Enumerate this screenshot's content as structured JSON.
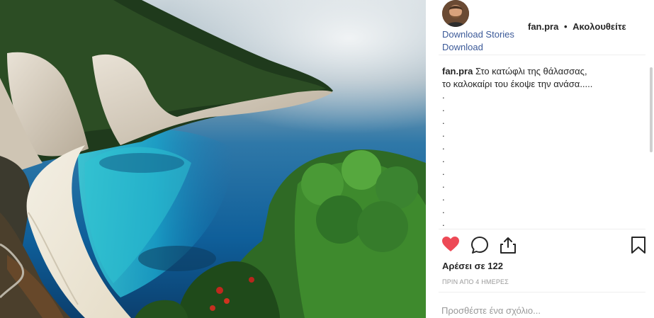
{
  "post": {
    "username": "fan.pra",
    "follow_separator": "•",
    "follow_label": "Ακολουθείτε",
    "download_stories_label": "Download Stories",
    "download_label": "Download",
    "caption_user": "fan.pra",
    "caption_line1": "Στο κατώφλι της θάλασσας,",
    "caption_line2": "το καλοκαίρι του έκοψε την ανάσα.....",
    "caption_dots": [
      ".",
      ".",
      ".",
      ".",
      ".",
      ".",
      ".",
      ".",
      ".",
      ".",
      "."
    ],
    "likes_text": "Αρέσει σε 122",
    "time_ago": "ΠΡΙΝ ΑΠΟ 4 ΗΜΕΡΕΣ",
    "comment_placeholder": "Προσθέστε ένα σχόλιο..."
  },
  "icons": {
    "like": "heart-icon",
    "comment": "comment-icon",
    "share": "share-icon",
    "save": "bookmark-icon"
  },
  "colors": {
    "like_active": "#ed4956",
    "link": "#3b5998",
    "muted": "#999999",
    "divider": "#efefef"
  }
}
